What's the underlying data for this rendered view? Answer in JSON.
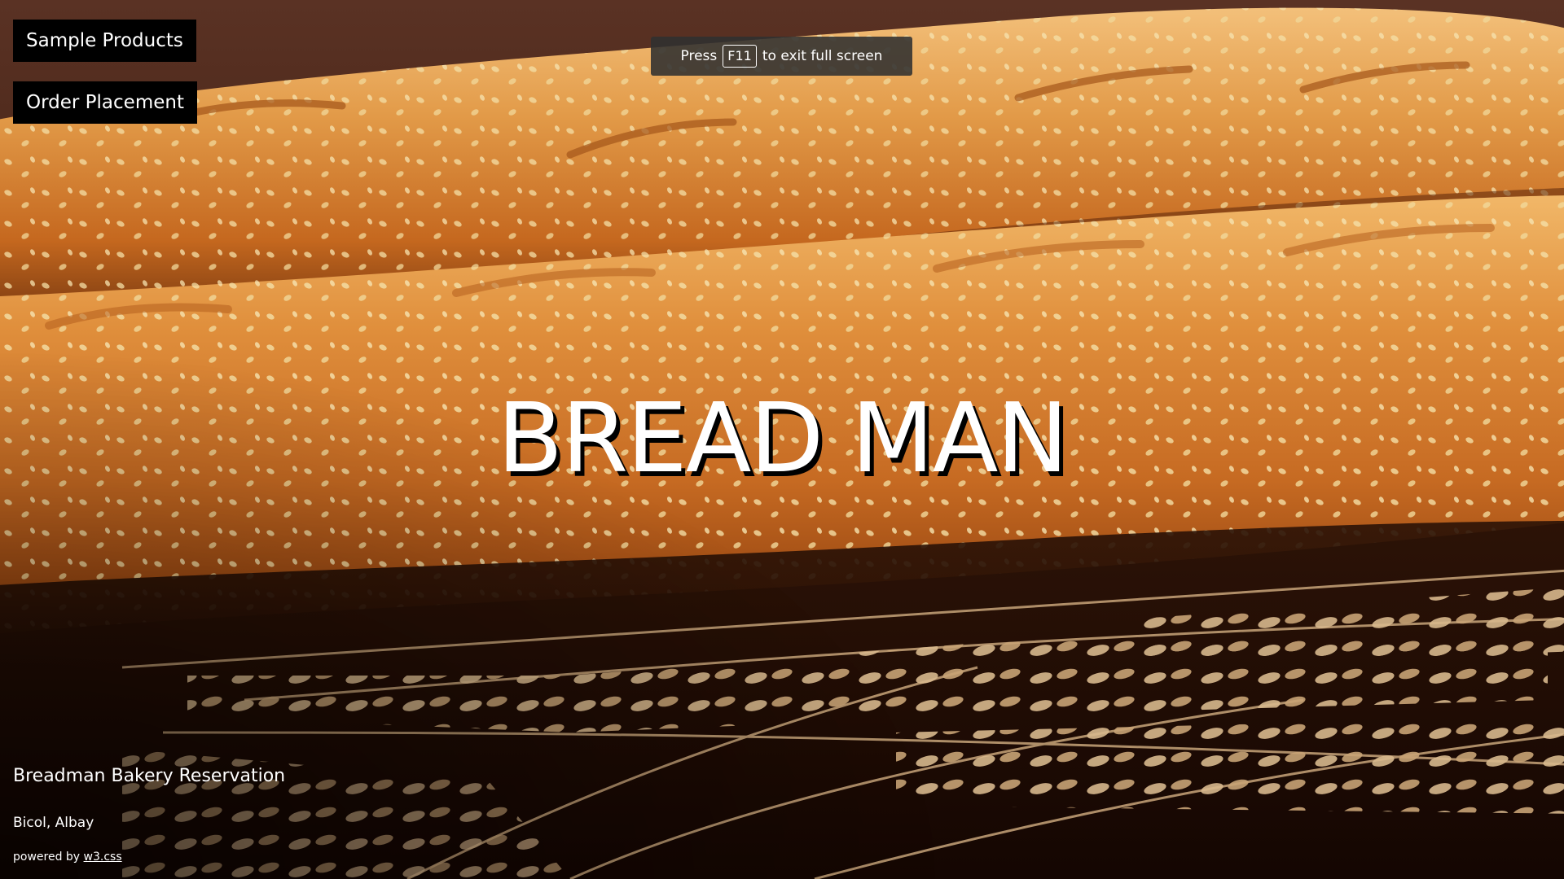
{
  "nav": {
    "sample_products": "Sample Products",
    "order_placement": "Order Placement"
  },
  "fullscreen_toast": {
    "prefix": "Press",
    "key": "F11",
    "suffix": "to exit full screen"
  },
  "hero": {
    "title": "BREAD MAN"
  },
  "footer": {
    "title": "Breadman Bakery Reservation",
    "location": "Bicol, Albay",
    "powered_prefix": "powered by",
    "powered_link": "w3.css"
  },
  "colors": {
    "button_bg": "#000000",
    "text": "#ffffff",
    "toast_bg": "#303030"
  }
}
